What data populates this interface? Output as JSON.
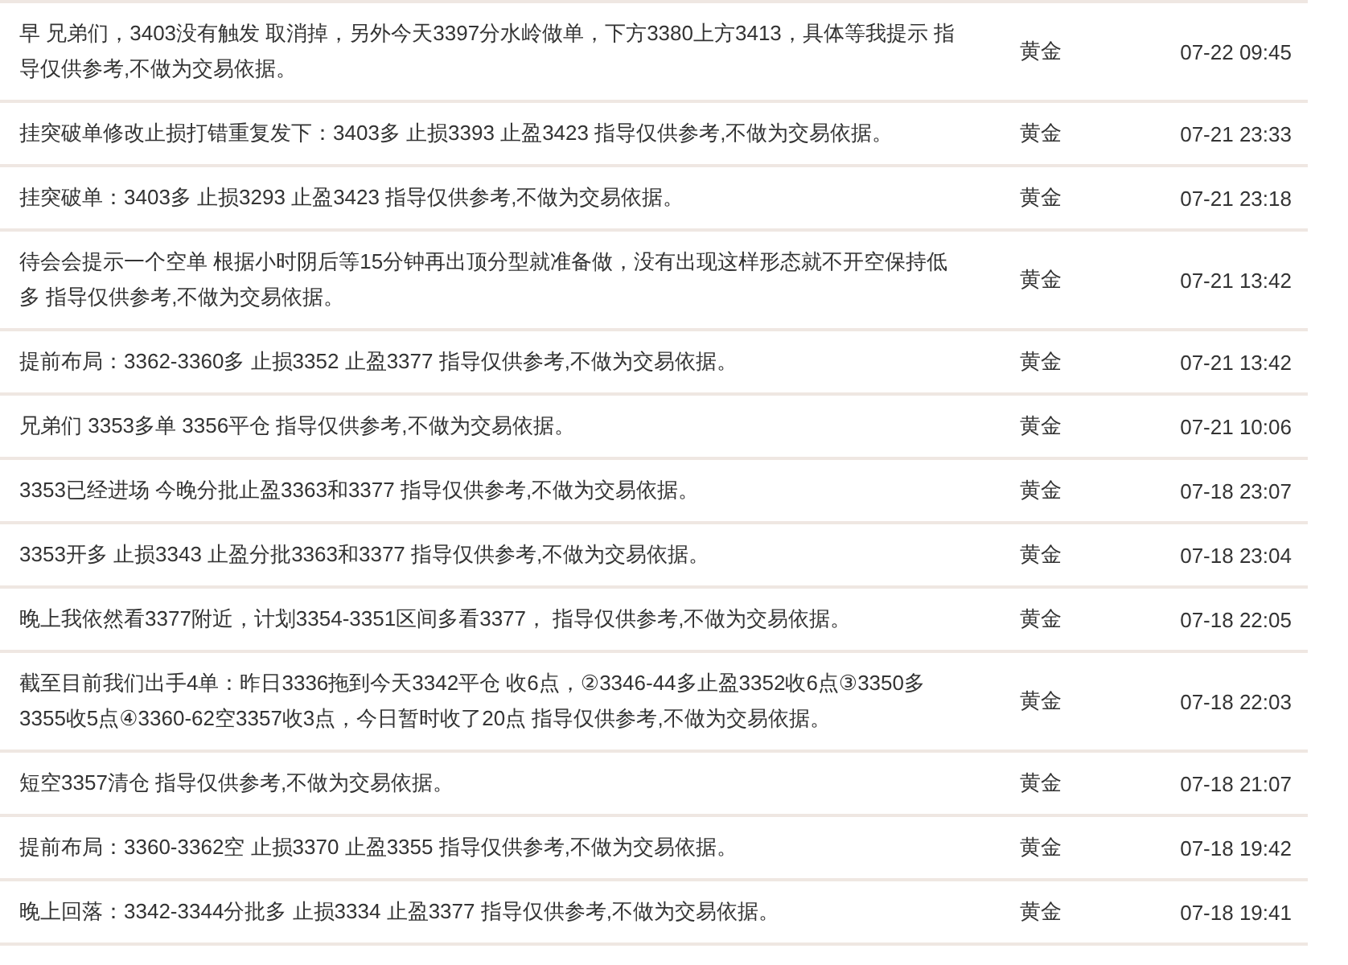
{
  "rows": [
    {
      "content": "早 兄弟们，3403没有触发 取消掉，另外今天3397分水岭做单，下方3380上方3413，具体等我提示 指导仅供参考,不做为交易依据。",
      "category": "黄金",
      "time": "07-22 09:45"
    },
    {
      "content": "挂突破单修改止损打错重复发下：3403多 止损3393 止盈3423 指导仅供参考,不做为交易依据。",
      "category": "黄金",
      "time": "07-21 23:33"
    },
    {
      "content": "挂突破单：3403多 止损3293 止盈3423 指导仅供参考,不做为交易依据。",
      "category": "黄金",
      "time": "07-21 23:18"
    },
    {
      "content": "待会会提示一个空单 根据小时阴后等15分钟再出顶分型就准备做，没有出现这样形态就不开空保持低多 指导仅供参考,不做为交易依据。",
      "category": "黄金",
      "time": "07-21 13:42"
    },
    {
      "content": "提前布局：3362-3360多 止损3352 止盈3377 指导仅供参考,不做为交易依据。",
      "category": "黄金",
      "time": "07-21 13:42"
    },
    {
      "content": "兄弟们 3353多单 3356平仓 指导仅供参考,不做为交易依据。",
      "category": "黄金",
      "time": "07-21 10:06"
    },
    {
      "content": "3353已经进场 今晚分批止盈3363和3377 指导仅供参考,不做为交易依据。",
      "category": "黄金",
      "time": "07-18 23:07"
    },
    {
      "content": "3353开多 止损3343 止盈分批3363和3377 指导仅供参考,不做为交易依据。",
      "category": "黄金",
      "time": "07-18 23:04"
    },
    {
      "content": "晚上我依然看3377附近，计划3354-3351区间多看3377， 指导仅供参考,不做为交易依据。",
      "category": "黄金",
      "time": "07-18 22:05"
    },
    {
      "content": "截至目前我们出手4单：昨日3336拖到今天3342平仓 收6点，②3346-44多止盈3352收6点③3350多3355收5点④3360-62空3357收3点，今日暂时收了20点 指导仅供参考,不做为交易依据。",
      "category": "黄金",
      "time": "07-18 22:03"
    },
    {
      "content": "短空3357清仓 指导仅供参考,不做为交易依据。",
      "category": "黄金",
      "time": "07-18 21:07"
    },
    {
      "content": "提前布局：3360-3362空 止损3370 止盈3355 指导仅供参考,不做为交易依据。",
      "category": "黄金",
      "time": "07-18 19:42"
    },
    {
      "content": "晚上回落：3342-3344分批多 止损3334 止盈3377 指导仅供参考,不做为交易依据。",
      "category": "黄金",
      "time": "07-18 19:41"
    }
  ]
}
